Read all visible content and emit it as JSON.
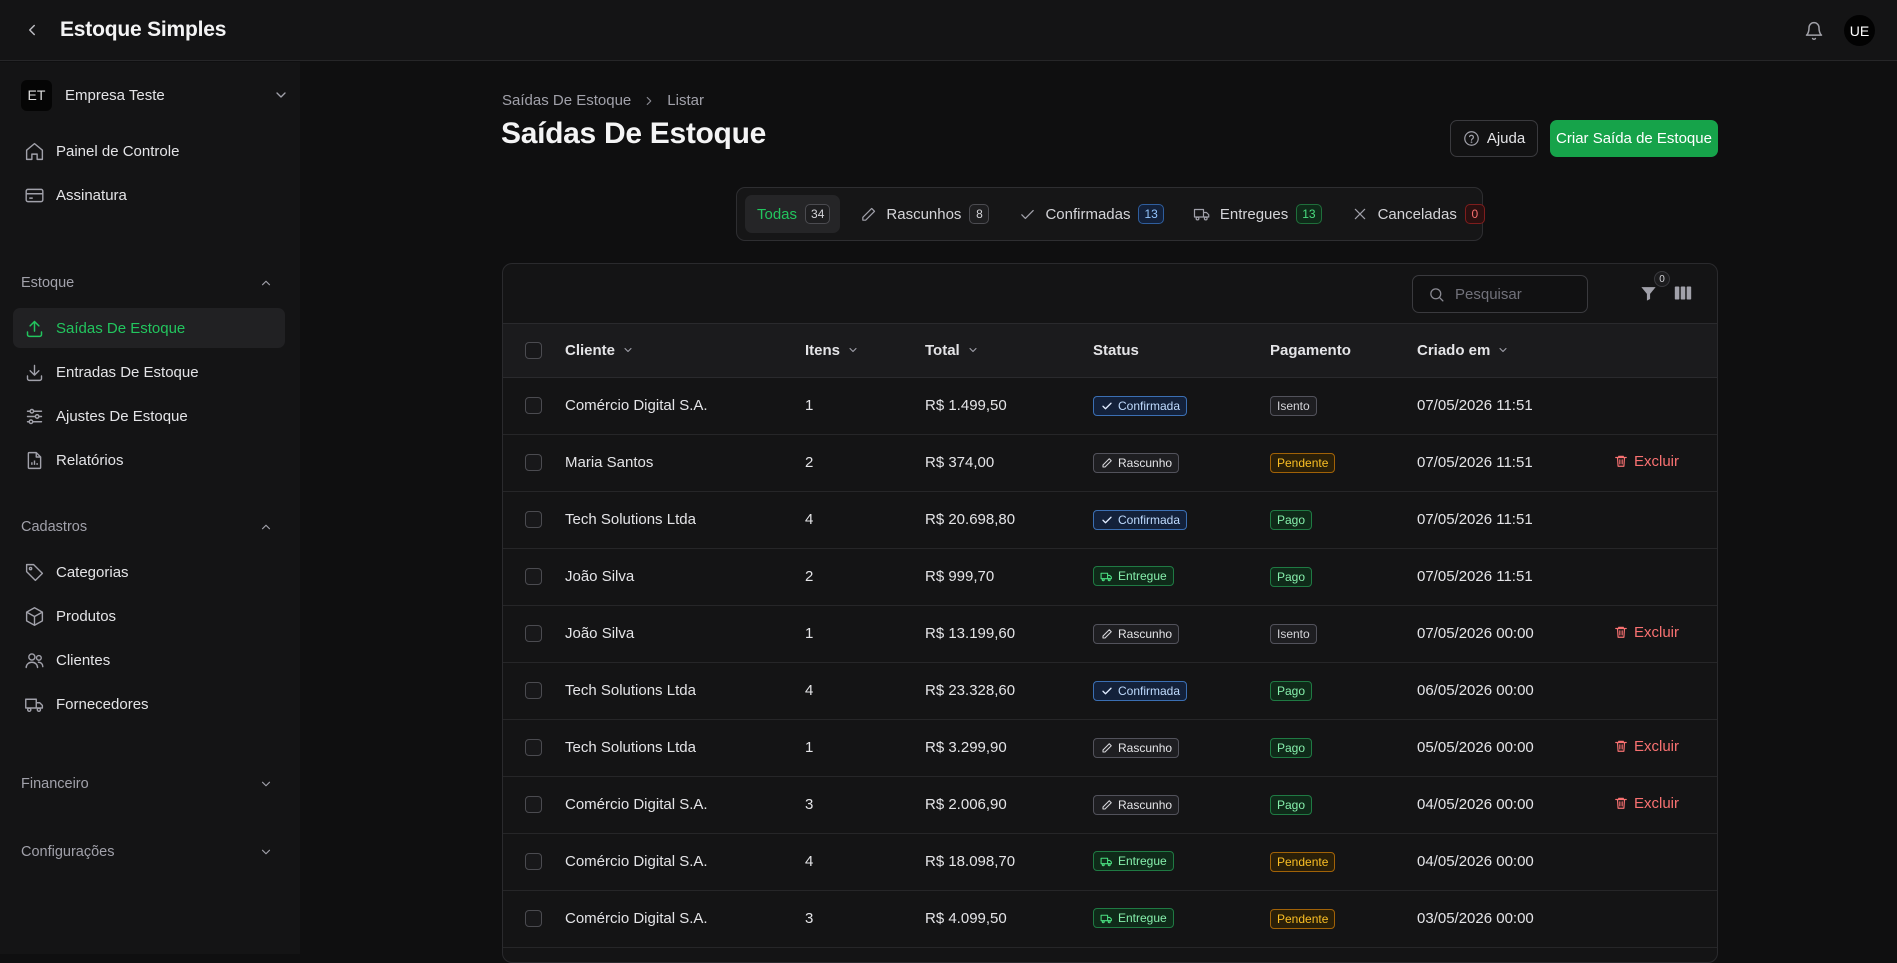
{
  "app": {
    "title": "Estoque Simples",
    "user_initials": "UE"
  },
  "sidebar": {
    "company": {
      "initials": "ET",
      "name": "Empresa Teste"
    },
    "top_items": [
      {
        "label": "Painel de Controle",
        "icon": "home-icon"
      },
      {
        "label": "Assinatura",
        "icon": "credit-card-icon"
      }
    ],
    "groups": {
      "estoque": {
        "label": "Estoque",
        "expanded": true
      },
      "cadastros": {
        "label": "Cadastros",
        "expanded": true
      },
      "financeiro": {
        "label": "Financeiro",
        "expanded": false
      },
      "configuracoes": {
        "label": "Configurações",
        "expanded": false
      }
    },
    "estoque_items": [
      {
        "label": "Saídas De Estoque",
        "icon": "upload-icon",
        "active": true
      },
      {
        "label": "Entradas De Estoque",
        "icon": "download-icon"
      },
      {
        "label": "Ajustes De Estoque",
        "icon": "sliders-icon"
      },
      {
        "label": "Relatórios",
        "icon": "report-icon"
      }
    ],
    "cadastros_items": [
      {
        "label": "Categorias",
        "icon": "tag-icon"
      },
      {
        "label": "Produtos",
        "icon": "box-icon"
      },
      {
        "label": "Clientes",
        "icon": "users-icon"
      },
      {
        "label": "Fornecedores",
        "icon": "truck-icon"
      }
    ]
  },
  "breadcrumb": {
    "parent": "Saídas De Estoque",
    "current": "Listar"
  },
  "page": {
    "title": "Saídas De Estoque",
    "help_label": "Ajuda",
    "create_label": "Criar Saída de Estoque"
  },
  "tabs": [
    {
      "label": "Todas",
      "count": "34",
      "active": true
    },
    {
      "label": "Rascunhos",
      "count": "8"
    },
    {
      "label": "Confirmadas",
      "count": "13"
    },
    {
      "label": "Entregues",
      "count": "13"
    },
    {
      "label": "Canceladas",
      "count": "0"
    }
  ],
  "toolbar": {
    "search_placeholder": "Pesquisar",
    "filter_count": "0"
  },
  "table": {
    "columns": {
      "cliente": "Cliente",
      "itens": "Itens",
      "total": "Total",
      "status": "Status",
      "pagamento": "Pagamento",
      "criado": "Criado em"
    },
    "delete_label": "Excluir",
    "rows": [
      {
        "cliente": "Comércio Digital S.A.",
        "itens": "1",
        "total": "R$ 1.499,50",
        "status": "Confirmada",
        "pagamento": "Isento",
        "criado": "07/05/2026 11:51",
        "deletable": false
      },
      {
        "cliente": "Maria Santos",
        "itens": "2",
        "total": "R$ 374,00",
        "status": "Rascunho",
        "pagamento": "Pendente",
        "criado": "07/05/2026 11:51",
        "deletable": true
      },
      {
        "cliente": "Tech Solutions Ltda",
        "itens": "4",
        "total": "R$ 20.698,80",
        "status": "Confirmada",
        "pagamento": "Pago",
        "criado": "07/05/2026 11:51",
        "deletable": false
      },
      {
        "cliente": "João Silva",
        "itens": "2",
        "total": "R$ 999,70",
        "status": "Entregue",
        "pagamento": "Pago",
        "criado": "07/05/2026 11:51",
        "deletable": false
      },
      {
        "cliente": "João Silva",
        "itens": "1",
        "total": "R$ 13.199,60",
        "status": "Rascunho",
        "pagamento": "Isento",
        "criado": "07/05/2026 00:00",
        "deletable": true
      },
      {
        "cliente": "Tech Solutions Ltda",
        "itens": "4",
        "total": "R$ 23.328,60",
        "status": "Confirmada",
        "pagamento": "Pago",
        "criado": "06/05/2026 00:00",
        "deletable": false
      },
      {
        "cliente": "Tech Solutions Ltda",
        "itens": "1",
        "total": "R$ 3.299,90",
        "status": "Rascunho",
        "pagamento": "Pago",
        "criado": "05/05/2026 00:00",
        "deletable": true
      },
      {
        "cliente": "Comércio Digital S.A.",
        "itens": "3",
        "total": "R$ 2.006,90",
        "status": "Rascunho",
        "pagamento": "Pago",
        "criado": "04/05/2026 00:00",
        "deletable": true
      },
      {
        "cliente": "Comércio Digital S.A.",
        "itens": "4",
        "total": "R$ 18.098,70",
        "status": "Entregue",
        "pagamento": "Pendente",
        "criado": "04/05/2026 00:00",
        "deletable": false
      },
      {
        "cliente": "Comércio Digital S.A.",
        "itens": "3",
        "total": "R$ 4.099,50",
        "status": "Entregue",
        "pagamento": "Pendente",
        "criado": "03/05/2026 00:00",
        "deletable": false
      }
    ]
  },
  "colors": {
    "accent": "#16a34a",
    "accent_text": "#22c55e",
    "background": "#0f0f10",
    "panel": "#141415",
    "danger": "#f87171"
  }
}
